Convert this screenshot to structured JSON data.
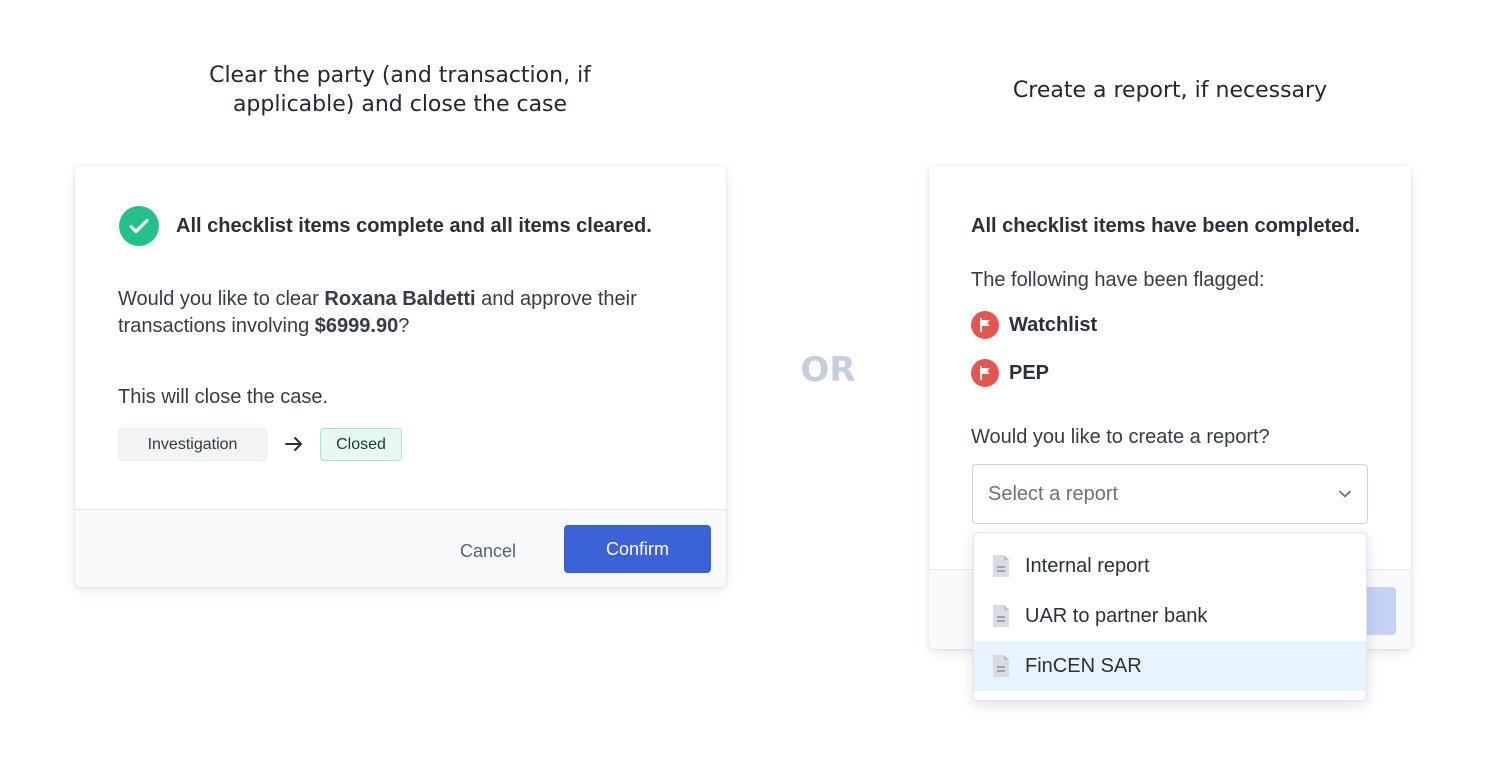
{
  "left_panel": {
    "caption_line1": "Clear the party (and transaction, if",
    "caption_line2": "applicable) and close the case",
    "heading": "All checklist items complete and all items cleared.",
    "question_prefix": "Would you like to clear ",
    "party_name": "Roxana Baldetti",
    "question_mid": " and approve their",
    "question_line2_prefix": "transactions involving ",
    "amount": "$6999.90",
    "question_suffix": "?",
    "close_note": "This will close the case.",
    "status_from": "Investigation",
    "status_to": "Closed",
    "cancel_label": "Cancel",
    "confirm_label": "Confirm"
  },
  "divider_label": "OR",
  "right_panel": {
    "caption": "Create a report, if necessary",
    "heading": "All checklist items have been completed.",
    "flagged_intro": "The following have been flagged:",
    "flags": [
      "Watchlist",
      "PEP"
    ],
    "report_question": "Would you like to create a report?",
    "select_placeholder": "Select a report",
    "options": [
      "Internal report",
      "UAR to partner bank",
      "FinCEN SAR"
    ],
    "highlighted_option": "FinCEN SAR"
  },
  "colors": {
    "success": "#22c189",
    "primary": "#3b62d6",
    "flag": "#e8554f",
    "closed_pill_bg": "#e6f8f1",
    "highlight": "#e8f4fd"
  },
  "icons": {
    "check": "check-circle-icon",
    "arrow": "arrow-right-icon",
    "flag": "flag-icon",
    "chevron": "chevron-down-icon",
    "document": "document-icon"
  }
}
